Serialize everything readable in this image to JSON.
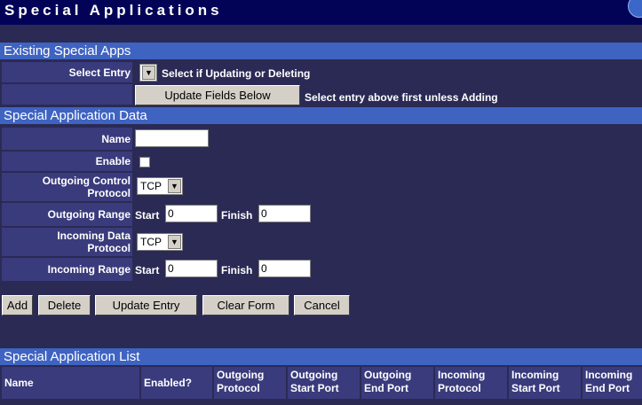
{
  "page": {
    "title": "Special Applications"
  },
  "existing": {
    "header": "Existing Special Apps",
    "select_entry_label": "Select Entry",
    "select_hint": "Select if Updating or Deleting",
    "update_fields_button": "Update Fields Below",
    "update_hint": "Select entry above first unless Adding"
  },
  "data_section": {
    "header": "Special Application Data",
    "name_label": "Name",
    "name_value": "",
    "enable_label": "Enable",
    "outgoing_protocol_label_1": "Outgoing Control",
    "outgoing_protocol_label_2": "Protocol",
    "outgoing_protocol_value": "TCP",
    "outgoing_range_label": "Outgoing Range",
    "incoming_protocol_label_1": "Incoming Data",
    "incoming_protocol_label_2": "Protocol",
    "incoming_protocol_value": "TCP",
    "incoming_range_label": "Incoming Range",
    "start_label": "Start",
    "finish_label": "Finish",
    "outgoing_start": "0",
    "outgoing_finish": "0",
    "incoming_start": "0",
    "incoming_finish": "0"
  },
  "actions": {
    "add": "Add",
    "delete": "Delete",
    "update_entry": "Update Entry",
    "clear_form": "Clear Form",
    "cancel": "Cancel"
  },
  "list": {
    "header": "Special Application List",
    "columns": {
      "name": "Name",
      "enabled": "Enabled?",
      "out_proto_1": "Outgoing",
      "out_proto_2": "Protocol",
      "out_start_1": "Outgoing",
      "out_start_2": "Start Port",
      "out_end_1": "Outgoing",
      "out_end_2": "End Port",
      "in_proto_1": "Incoming",
      "in_proto_2": "Protocol",
      "in_start_1": "Incoming",
      "in_start_2": "Start Port",
      "in_end_1": "Incoming",
      "in_end_2": "End Port"
    }
  }
}
